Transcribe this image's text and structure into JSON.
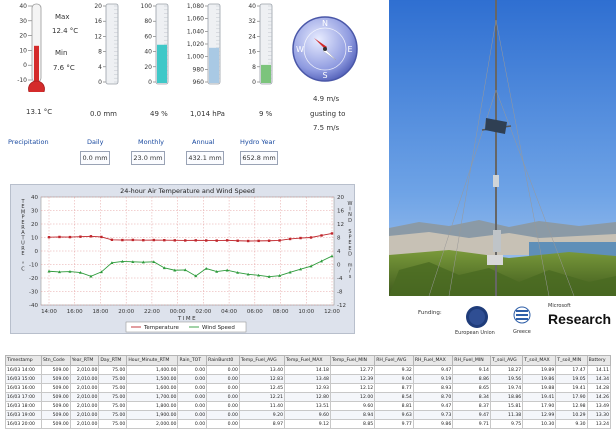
{
  "thermometer": {
    "ticks": [
      "40",
      "30",
      "20",
      "10",
      "0",
      "-10"
    ],
    "max_label": "Max",
    "max_value": "12.4 °C",
    "min_label": "Min",
    "min_value": "7.6 °C",
    "current": "13.1 °C",
    "level": 13.1
  },
  "rain_gauge": {
    "ticks": [
      "20",
      "16",
      "12",
      "8",
      "4",
      "0"
    ],
    "value": "0.0 mm",
    "level": 0.0
  },
  "rh_gauge": {
    "ticks": [
      "100",
      "80",
      "60",
      "40",
      "20",
      "0"
    ],
    "value": "49 %",
    "level": 49
  },
  "pressure_gauge": {
    "ticks": [
      "1,080",
      "1,060",
      "1,040",
      "1,020",
      "1,000",
      "980",
      "960"
    ],
    "value": "1,014 hPa",
    "level": 1014
  },
  "fuel_gauge": {
    "ticks": [
      "40",
      "32",
      "24",
      "16",
      "8",
      "0"
    ],
    "value": "9 %",
    "level": 9
  },
  "compass": {
    "n": "N",
    "e": "E",
    "s": "S",
    "w": "W",
    "speed": "4.9 m/s",
    "gusting_label": "gusting to",
    "gust": "7.5 m/s"
  },
  "precipitation": {
    "label": "Precipitation",
    "daily_label": "Daily",
    "daily_value": "0.0 mm",
    "monthly_label": "Monthly",
    "monthly_value": "23.0 mm",
    "annual_label": "Annual",
    "annual_value": "432.1 mm",
    "hydro_label": "Hydro Year",
    "hydro_value": "652.8 mm"
  },
  "funding": {
    "label": "Funding:",
    "eu_text": "European Union",
    "greece_text": "Greece",
    "ms_small": "Microsoft",
    "ms_big": "Research"
  },
  "chart_data": {
    "type": "line",
    "title": "24-hour Air Temperature and Wind Speed",
    "xlabel": "TIME",
    "ylabel_left": "TEMPERATURE °C",
    "ylabel_right": "WIND SPEED m/s",
    "x_ticks": [
      "14:00",
      "16:00",
      "18:00",
      "20:00",
      "22:00",
      "00:00",
      "02:00",
      "04:00",
      "06:00",
      "08:00",
      "10:00",
      "12:00"
    ],
    "yleft_ticks": [
      "40",
      "30",
      "20",
      "10",
      "0",
      "-10",
      "-20",
      "-30",
      "-40"
    ],
    "yright_ticks": [
      "20",
      "16",
      "12",
      "8",
      "4",
      "0",
      "-4",
      "-8",
      "-12"
    ],
    "ylim_left": [
      -40,
      40
    ],
    "ylim_right": [
      -12,
      20
    ],
    "grid": true,
    "legend_position": "bottom",
    "series": [
      {
        "name": "Temperature",
        "color": "#c0262c",
        "axis": "left",
        "values": [
          10.2,
          10.4,
          10.3,
          10.6,
          10.9,
          10.4,
          8.3,
          8.1,
          8.2,
          8.0,
          8.1,
          8.0,
          7.9,
          7.8,
          7.9,
          7.8,
          7.7,
          7.9,
          7.6,
          7.4,
          7.5,
          7.6,
          7.8,
          8.9,
          9.6,
          10.0,
          11.5,
          13.0
        ]
      },
      {
        "name": "Wind Speed",
        "color": "#2e9b3b",
        "axis": "right",
        "values": [
          -2.0,
          -2.2,
          -2.1,
          -2.4,
          -3.5,
          -2.2,
          0.5,
          0.9,
          0.8,
          0.7,
          0.8,
          -1.0,
          -1.7,
          -1.6,
          -3.4,
          -1.2,
          -2.1,
          -1.7,
          -2.4,
          -2.9,
          -3.2,
          -3.6,
          -3.3,
          -2.3,
          -1.4,
          -0.5,
          1.0,
          2.5
        ]
      }
    ]
  },
  "table": {
    "columns": [
      "Timestamp",
      "Stn_Code",
      "Year_RTM",
      "Day_RTM",
      "Hour_Minute_RTM",
      "Rain_TOT",
      "RainBurst0",
      "Temp_Fuel_AVG",
      "Temp_Fuel_MAX",
      "Temp_Fuel_MIN",
      "RH_Fuel_AVG",
      "RH_Fuel_MAX",
      "RH_Fuel_MIN",
      "T_soil_AVG",
      "T_soil_MAX",
      "T_soil_MIN",
      "Battery"
    ],
    "rows": [
      [
        "16/03 14:00",
        "509.00",
        "2,010.00",
        "75.00",
        "1,400.00",
        "0.00",
        "0.00",
        "13.40",
        "14.18",
        "12.77",
        "9.32",
        "9.47",
        "9.14",
        "18.27",
        "19.89",
        "17.47",
        "14.11"
      ],
      [
        "16/03 15:00",
        "509.00",
        "2,010.00",
        "75.00",
        "1,500.00",
        "0.00",
        "0.00",
        "12.83",
        "13.48",
        "12.39",
        "9.04",
        "9.19",
        "8.86",
        "19.56",
        "19.86",
        "19.05",
        "14.34"
      ],
      [
        "16/03 16:00",
        "509.00",
        "2,010.00",
        "75.00",
        "1,600.00",
        "0.00",
        "0.00",
        "12.45",
        "12.93",
        "12.12",
        "8.77",
        "8.93",
        "8.65",
        "19.74",
        "19.88",
        "19.41",
        "14.28"
      ],
      [
        "16/03 17:00",
        "509.00",
        "2,010.00",
        "75.00",
        "1,700.00",
        "0.00",
        "0.00",
        "12.21",
        "12.80",
        "12.00",
        "8.54",
        "8.70",
        "8.34",
        "18.86",
        "19.41",
        "17.90",
        "14.26"
      ],
      [
        "16/03 18:00",
        "509.00",
        "2,010.00",
        "75.00",
        "1,800.00",
        "0.00",
        "0.00",
        "11.40",
        "13.51",
        "9.60",
        "8.81",
        "9.47",
        "8.37",
        "15.81",
        "17.90",
        "12.98",
        "13.49"
      ],
      [
        "16/03 19:00",
        "509.00",
        "2,010.00",
        "75.00",
        "1,900.00",
        "0.00",
        "0.00",
        "9.20",
        "9.60",
        "8.94",
        "9.63",
        "9.73",
        "9.47",
        "11.38",
        "12.99",
        "10.29",
        "13.30"
      ],
      [
        "16/03 20:00",
        "509.00",
        "2,010.00",
        "75.00",
        "2,000.00",
        "0.00",
        "0.00",
        "8.97",
        "9.12",
        "8.85",
        "9.77",
        "9.86",
        "9.71",
        "9.75",
        "10.30",
        "9.30",
        "13.24"
      ]
    ]
  }
}
